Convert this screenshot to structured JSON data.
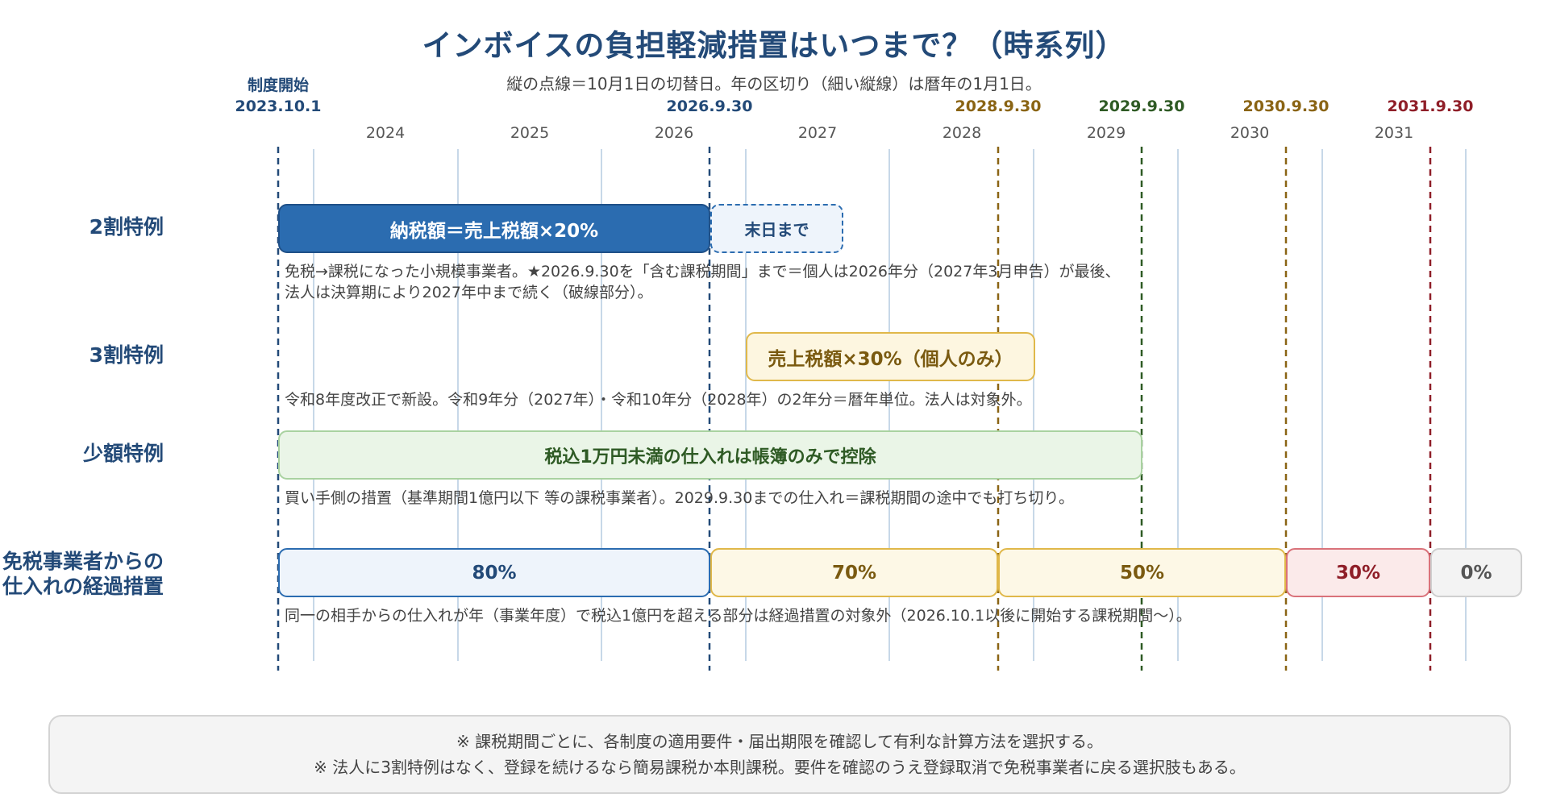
{
  "title": "インボイスの負担軽減措置はいつまで？（時系列）",
  "subtitle": "縦の点線＝10月1日の切替日。年の区切り（細い縦線）は暦年の1月1日。",
  "markers": [
    {
      "top": "制度開始",
      "date": "2023.10.1",
      "color": "#234a78"
    },
    {
      "date": "2026.9.30",
      "color": "#234a78"
    },
    {
      "date": "2028.9.30",
      "color": "#8a6414"
    },
    {
      "date": "2029.9.30",
      "color": "#2e5a24"
    },
    {
      "date": "2030.9.30",
      "color": "#8a6414"
    },
    {
      "date": "2031.9.30",
      "color": "#8f1e28"
    }
  ],
  "years": [
    "2024",
    "2025",
    "2026",
    "2027",
    "2028",
    "2029",
    "2030",
    "2031"
  ],
  "rows": {
    "niwari": {
      "label": "2割特例",
      "bar_main": "納税額＝売上税額×20%",
      "bar_ext": "末日まで",
      "note_line1": "免税→課税になった小規模事業者。★2026.9.30を「含む課税期間」まで＝個人は2026年分（2027年3月申告）が最後、",
      "note_line2": "法人は決算期により2027年中まで続く（破線部分）。"
    },
    "sanwari": {
      "label": "3割特例",
      "bar": "売上税額×30%（個人のみ）",
      "note": "令和8年度改正で新設。令和9年分（2027年）・令和10年分（2028年）の2年分＝暦年単位。法人は対象外。"
    },
    "shogaku": {
      "label": "少額特例",
      "bar": "税込1万円未満の仕入れは帳簿のみで控除",
      "note": "買い手側の措置（基準期間1億円以下 等の課税事業者）。2029.9.30までの仕入れ＝課税期間の途中でも打ち切り。"
    },
    "keika": {
      "label_line1": "免税事業者からの",
      "label_line2": "仕入れの経過措置",
      "bars": [
        "80%",
        "70%",
        "50%",
        "30%",
        "0%"
      ],
      "note": "同一の相手からの仕入れが年（事業年度）で税込1億円を超える部分は経過措置の対象外（2026.10.1以後に開始する課税期間〜）。"
    }
  },
  "footer": {
    "line1": "※ 課税期間ごとに、各制度の適用要件・届出期限を確認して有利な計算方法を選択する。",
    "line2": "※ 法人に3割特例はなく、登録を続けるなら簡易課税か本則課税。要件を確認のうえ登録取消で免税事業者に戻る選択肢もある。"
  },
  "colors": {
    "blue": "#2b6cb0",
    "navy": "#234a78",
    "gold": "#e0b84a",
    "green": "#a9d2a0",
    "red": "#d9727a",
    "gray": "#cfcfcf"
  }
}
